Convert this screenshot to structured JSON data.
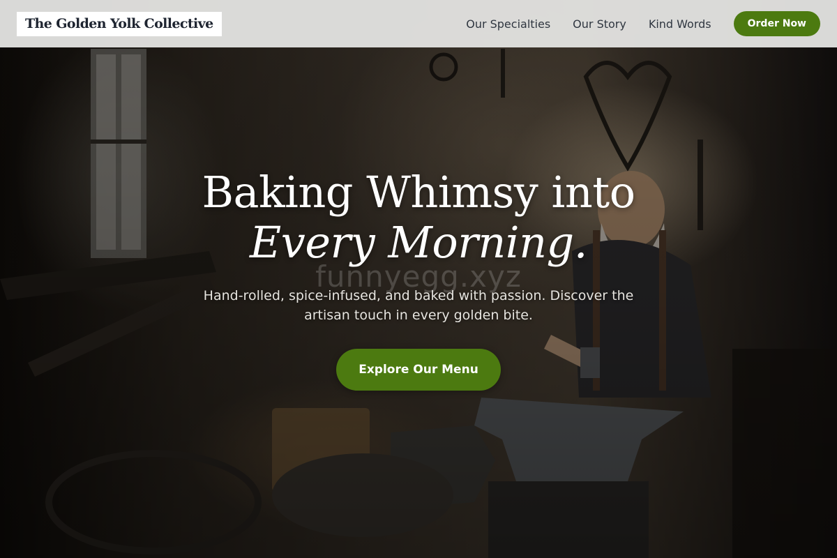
{
  "header": {
    "brand": "The Golden Yolk Collective",
    "nav": [
      {
        "label": "Our Specialties"
      },
      {
        "label": "Our Story"
      },
      {
        "label": "Kind Words"
      }
    ],
    "order_button": "Order Now"
  },
  "hero": {
    "headline_line1": "Baking Whimsy into",
    "headline_line2": "Every Morning.",
    "watermark": "funnyegg.xyz",
    "subtitle": "Hand-rolled, spice-infused, and baked with passion. Discover the artisan touch in every golden bite.",
    "cta_button": "Explore Our Menu",
    "background_image": "blacksmith-workshop-photo"
  },
  "colors": {
    "accent": "#4c7a10",
    "header_bg": "#e2e2e0",
    "text_dark": "#1e2430"
  }
}
